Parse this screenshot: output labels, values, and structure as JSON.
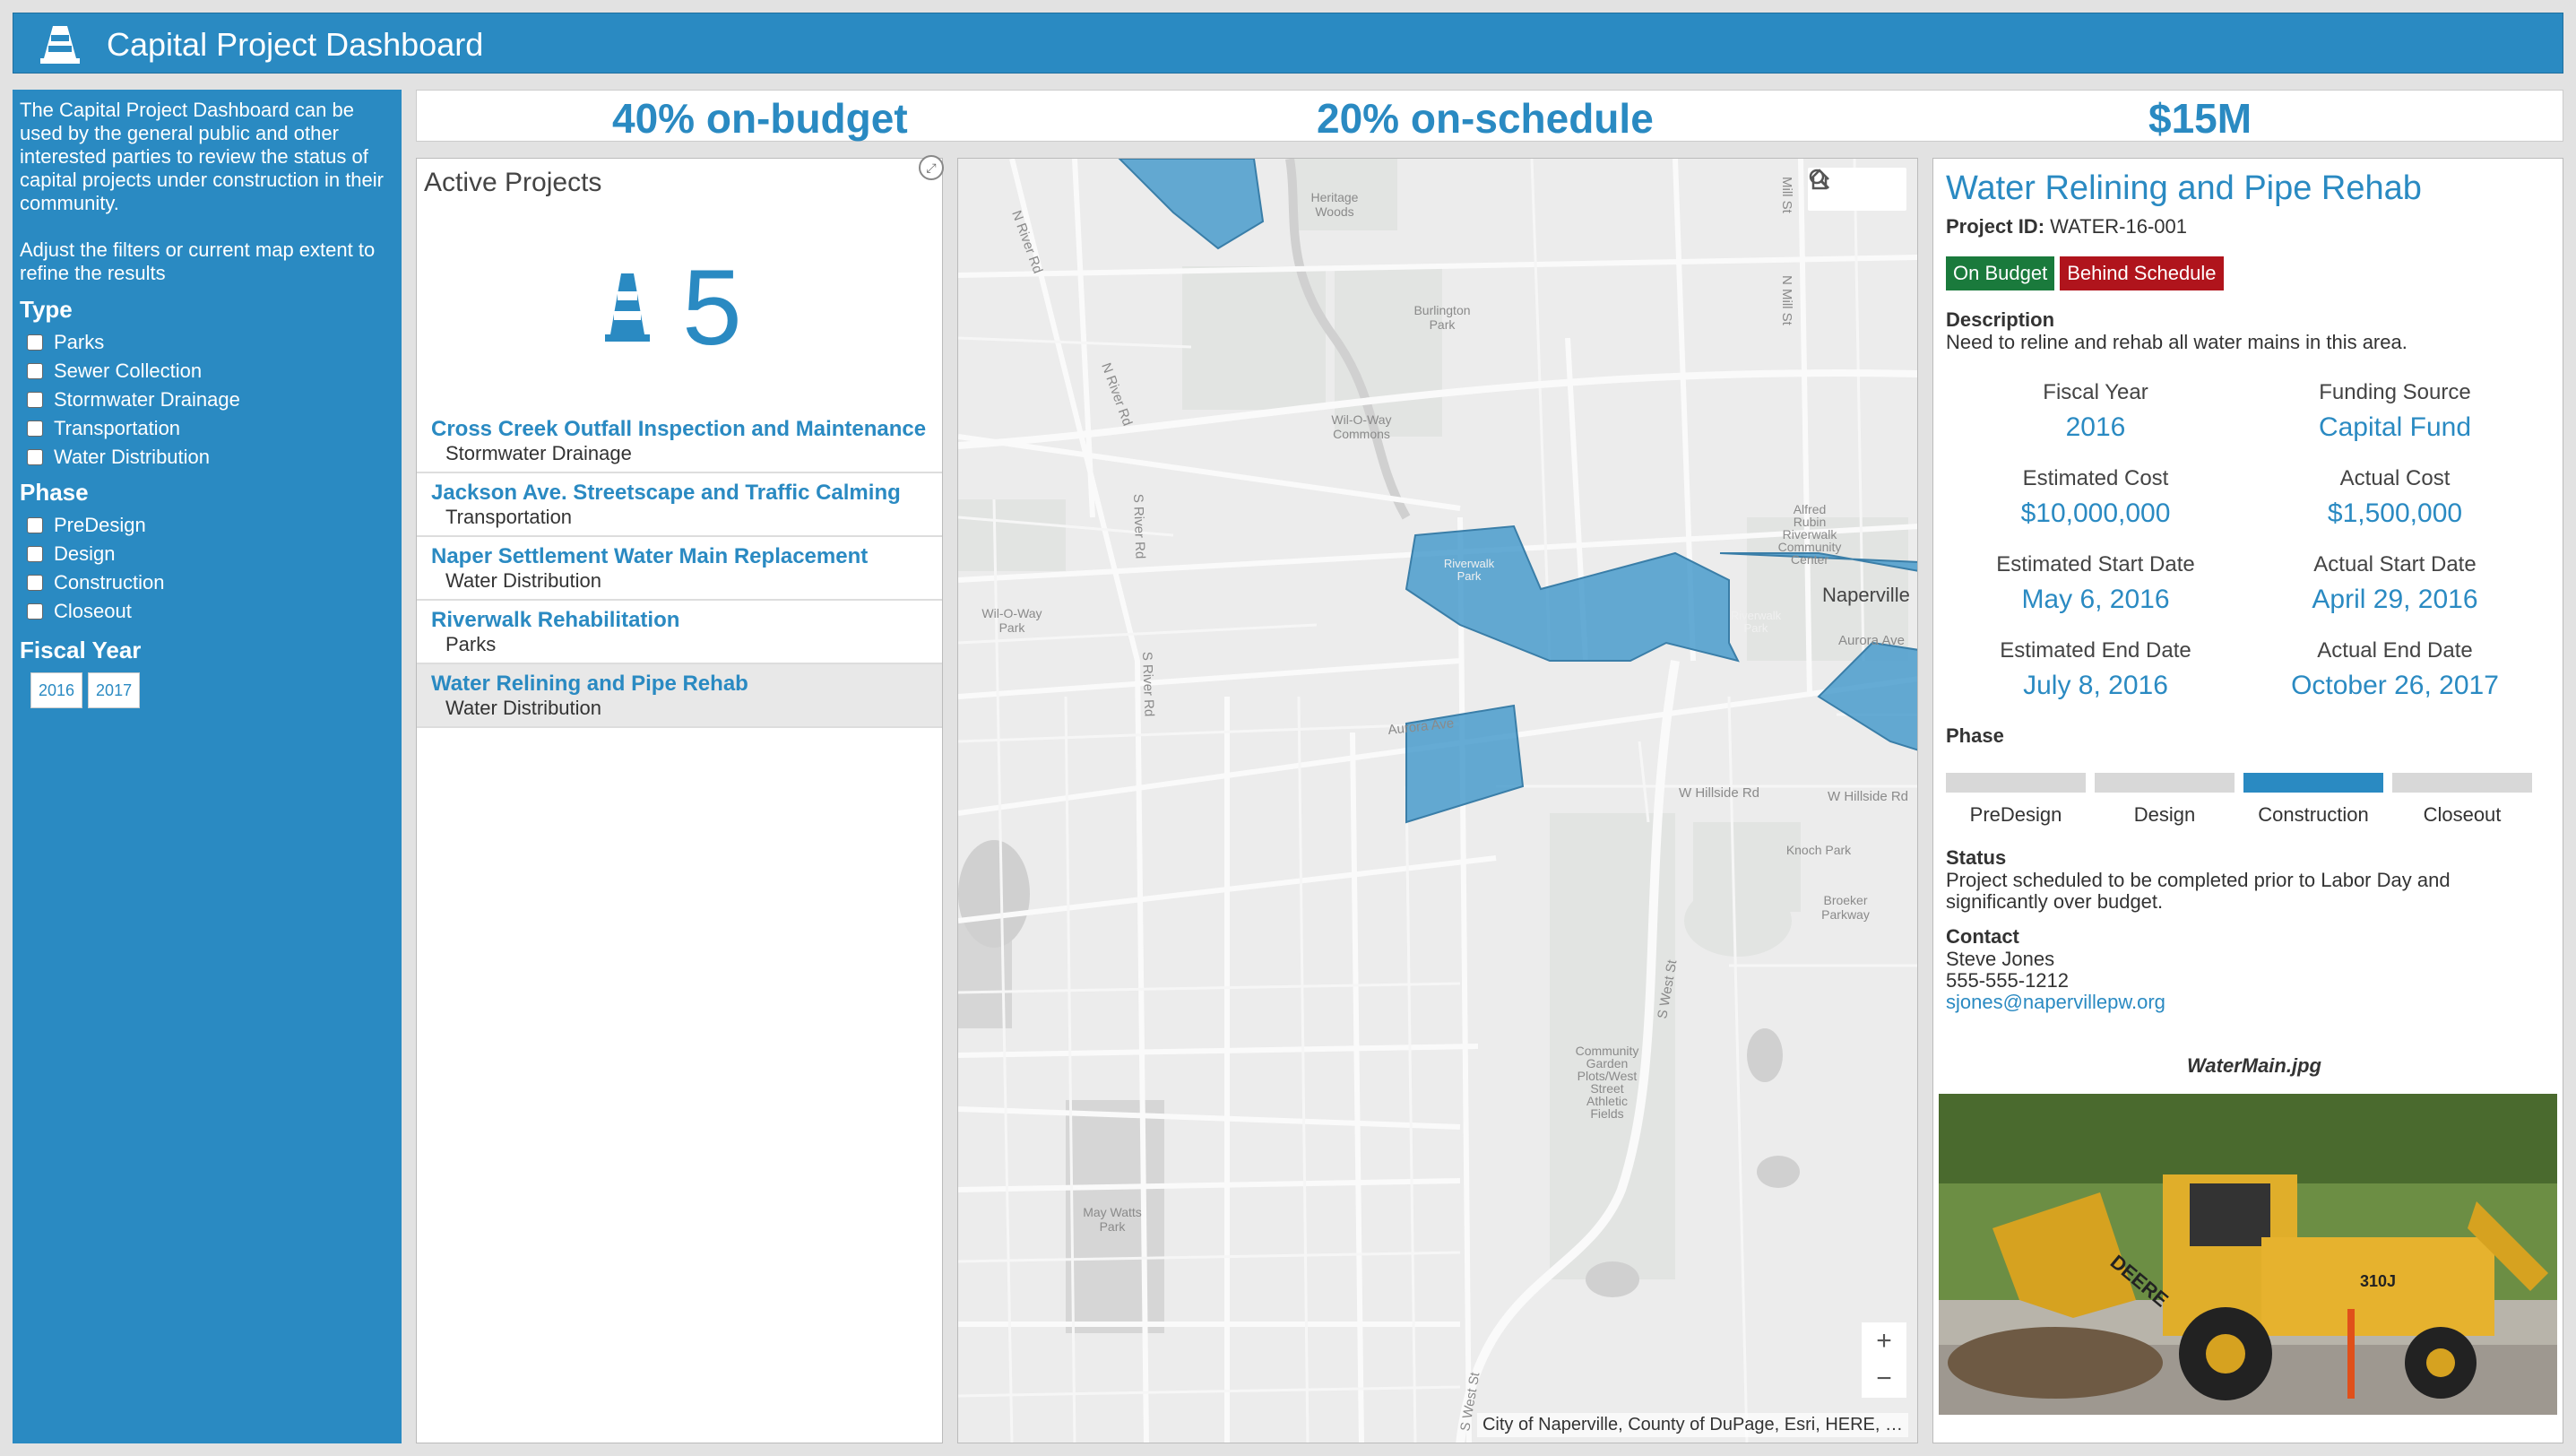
{
  "header": {
    "title": "Capital Project Dashboard",
    "icon": "traffic-cone-icon"
  },
  "sidebar": {
    "intro": "The Capital Project Dashboard can be used by the general public and other interested parties to review the status of capital projects under construction in their community.",
    "hint": "Adjust the filters or current map extent to refine the results",
    "type_heading": "Type",
    "types": [
      "Parks",
      "Sewer Collection",
      "Stormwater Drainage",
      "Transportation",
      "Water Distribution"
    ],
    "phase_heading": "Phase",
    "phases": [
      "PreDesign",
      "Design",
      "Construction",
      "Closeout"
    ],
    "fiscal_heading": "Fiscal Year",
    "years": [
      "2016",
      "2017"
    ]
  },
  "stats": {
    "budget": "40% on-budget",
    "schedule": "20% on-schedule",
    "total": "$15M"
  },
  "projects": {
    "title": "Active Projects",
    "count": "5",
    "items": [
      {
        "name": "Cross Creek Outfall Inspection and Maintenance",
        "type": "Stormwater Drainage"
      },
      {
        "name": "Jackson Ave. Streetscape and Traffic Calming",
        "type": "Transportation"
      },
      {
        "name": "Naper Settlement Water Main Replacement",
        "type": "Water Distribution"
      },
      {
        "name": "Riverwalk Rehabilitation",
        "type": "Parks"
      },
      {
        "name": "Water Relining and Pipe Rehab",
        "type": "Water Distribution"
      }
    ]
  },
  "map": {
    "labels": {
      "heritage": "Heritage",
      "woods": "Woods",
      "burlington": "Burlington",
      "park": "Park",
      "wiloway": "Wil-O-Way",
      "commons": "Commons",
      "alfred": "Alfred",
      "rubin": "Rubin",
      "riverwalk": "Riverwalk",
      "community": "Community",
      "center": "Center",
      "naperville": "Naperville",
      "riverwalk_park": "Riverwalk",
      "park2": "Park",
      "aurora_ave": "Aurora Ave",
      "aurora_ave2": "Aurora Ave",
      "w_hillside": "W Hillside Rd",
      "w_hillside2": "W Hillside Rd",
      "knoch": "Knoch Park",
      "broeker": "Broeker",
      "parkway": "Parkway",
      "community_garden": "Community",
      "garden": "Garden",
      "plots": "Plots/West",
      "street": "Street",
      "athletic": "Athletic",
      "fields": "Fields",
      "may_watts": "May Watts",
      "park3": "Park",
      "wiloway2": "Wil-O-Way",
      "park4": "Park",
      "n_river": "N River Rd",
      "n_river2": "N River Rd",
      "s_river": "S River Rd",
      "s_river2": "S River Rd",
      "mill_st": "Mill St",
      "n_mill": "N Mill St",
      "s_west": "S West St",
      "s_west2": "S West St"
    },
    "zoom_in": "+",
    "zoom_out": "−",
    "attribution": "City of Naperville, County of DuPage, Esri, HERE, …"
  },
  "details": {
    "title": "Water Relining and Pipe Rehab",
    "project_id_label": "Project ID:",
    "project_id": "WATER-16-001",
    "badge_budget": "On Budget",
    "badge_schedule": "Behind Schedule",
    "badge_budget_color": "#1a7a3c",
    "badge_schedule_color": "#b0141c",
    "description_label": "Description",
    "description": "Need to reline and rehab all water mains in this area.",
    "fiscal_year_label": "Fiscal Year",
    "fiscal_year": "2016",
    "funding_label": "Funding Source",
    "funding": "Capital Fund",
    "est_cost_label": "Estimated Cost",
    "est_cost": "$10,000,000",
    "act_cost_label": "Actual Cost",
    "act_cost": "$1,500,000",
    "est_start_label": "Estimated Start Date",
    "est_start": "May 6, 2016",
    "act_start_label": "Actual Start Date",
    "act_start": "April 29, 2016",
    "est_end_label": "Estimated End Date",
    "est_end": "July 8, 2016",
    "act_end_label": "Actual End Date",
    "act_end": "October 26, 2017",
    "phase_label": "Phase",
    "phases": [
      "PreDesign",
      "Design",
      "Construction",
      "Closeout"
    ],
    "current_phase": "Construction",
    "status_label": "Status",
    "status": "Project scheduled to be completed prior to Labor Day and significantly over budget.",
    "contact_label": "Contact",
    "contact_name": "Steve Jones",
    "contact_phone": "555-555-1212",
    "contact_email": "sjones@napervillepw.org",
    "image_caption": "WaterMain.jpg",
    "photo_logo": "DEERE",
    "photo_model": "310J"
  },
  "colors": {
    "accent": "#2a8ac2",
    "polygon": "#4a9ccc"
  }
}
